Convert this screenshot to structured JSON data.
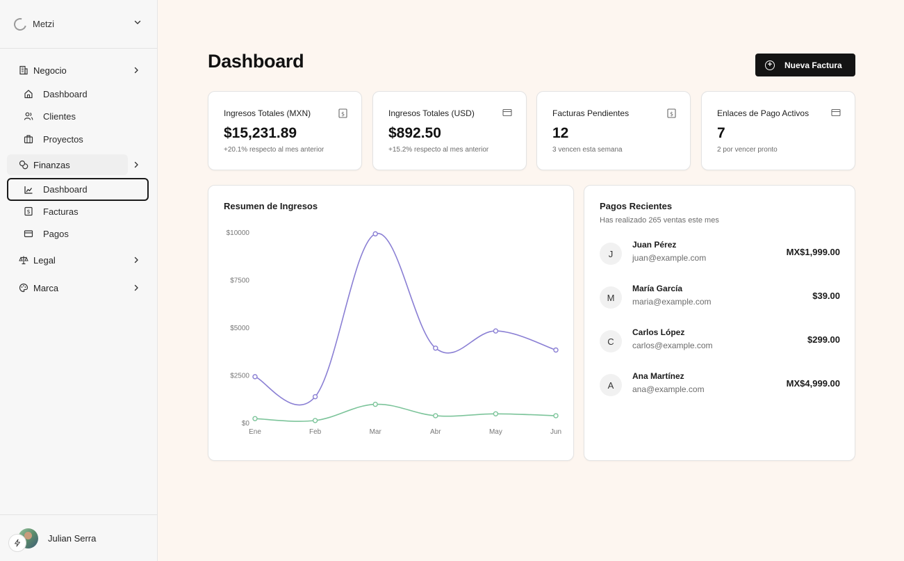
{
  "workspace": {
    "name": "Metzi"
  },
  "sidebar": {
    "groups": [
      {
        "label": "Negocio",
        "items": [
          {
            "label": "Dashboard"
          },
          {
            "label": "Clientes"
          },
          {
            "label": "Proyectos"
          }
        ]
      },
      {
        "label": "Finanzas",
        "items": [
          {
            "label": "Dashboard"
          },
          {
            "label": "Facturas"
          },
          {
            "label": "Pagos"
          }
        ]
      },
      {
        "label": "Legal"
      },
      {
        "label": "Marca"
      }
    ]
  },
  "user": {
    "name": "Julian Serra"
  },
  "main": {
    "title": "Dashboard",
    "new_button": "Nueva Factura"
  },
  "stats": [
    {
      "title": "Ingresos Totales (MXN)",
      "value": "$15,231.89",
      "sub": "+20.1% respecto al mes anterior",
      "icon": "dollar-doc-icon"
    },
    {
      "title": "Ingresos Totales (USD)",
      "value": "$892.50",
      "sub": "+15.2% respecto al mes anterior",
      "icon": "card-icon"
    },
    {
      "title": "Facturas Pendientes",
      "value": "12",
      "sub": "3 vencen esta semana",
      "icon": "dollar-doc-icon"
    },
    {
      "title": "Enlaces de Pago Activos",
      "value": "7",
      "sub": "2 por vencer pronto",
      "icon": "card-icon"
    }
  ],
  "chart": {
    "title": "Resumen de Ingresos"
  },
  "chart_data": {
    "type": "line",
    "title": "Resumen de Ingresos",
    "categories": [
      "Ene",
      "Feb",
      "Mar",
      "Abr",
      "May",
      "Jun"
    ],
    "y_ticks": [
      "$0",
      "$2500",
      "$5000",
      "$7500",
      "$10000"
    ],
    "ylim": [
      0,
      10000
    ],
    "series": [
      {
        "values": [
          2450,
          1400,
          9950,
          3950,
          4850,
          3850
        ],
        "color": "#8a7fd4"
      },
      {
        "values": [
          250,
          150,
          1000,
          400,
          500,
          400
        ],
        "color": "#7cc49a"
      }
    ],
    "grid": false
  },
  "payments": {
    "title": "Pagos Recientes",
    "subtitle": "Has realizado 265 ventas este mes",
    "rows": [
      {
        "initial": "J",
        "name": "Juan Pérez",
        "email": "juan@example.com",
        "amount": "MX$1,999.00"
      },
      {
        "initial": "M",
        "name": "María García",
        "email": "maria@example.com",
        "amount": "$39.00"
      },
      {
        "initial": "C",
        "name": "Carlos López",
        "email": "carlos@example.com",
        "amount": "$299.00"
      },
      {
        "initial": "A",
        "name": "Ana Martínez",
        "email": "ana@example.com",
        "amount": "MX$4,999.00"
      }
    ]
  },
  "colors": {
    "accent": "#141414",
    "series1": "#8a7fd4",
    "series2": "#7cc49a"
  }
}
